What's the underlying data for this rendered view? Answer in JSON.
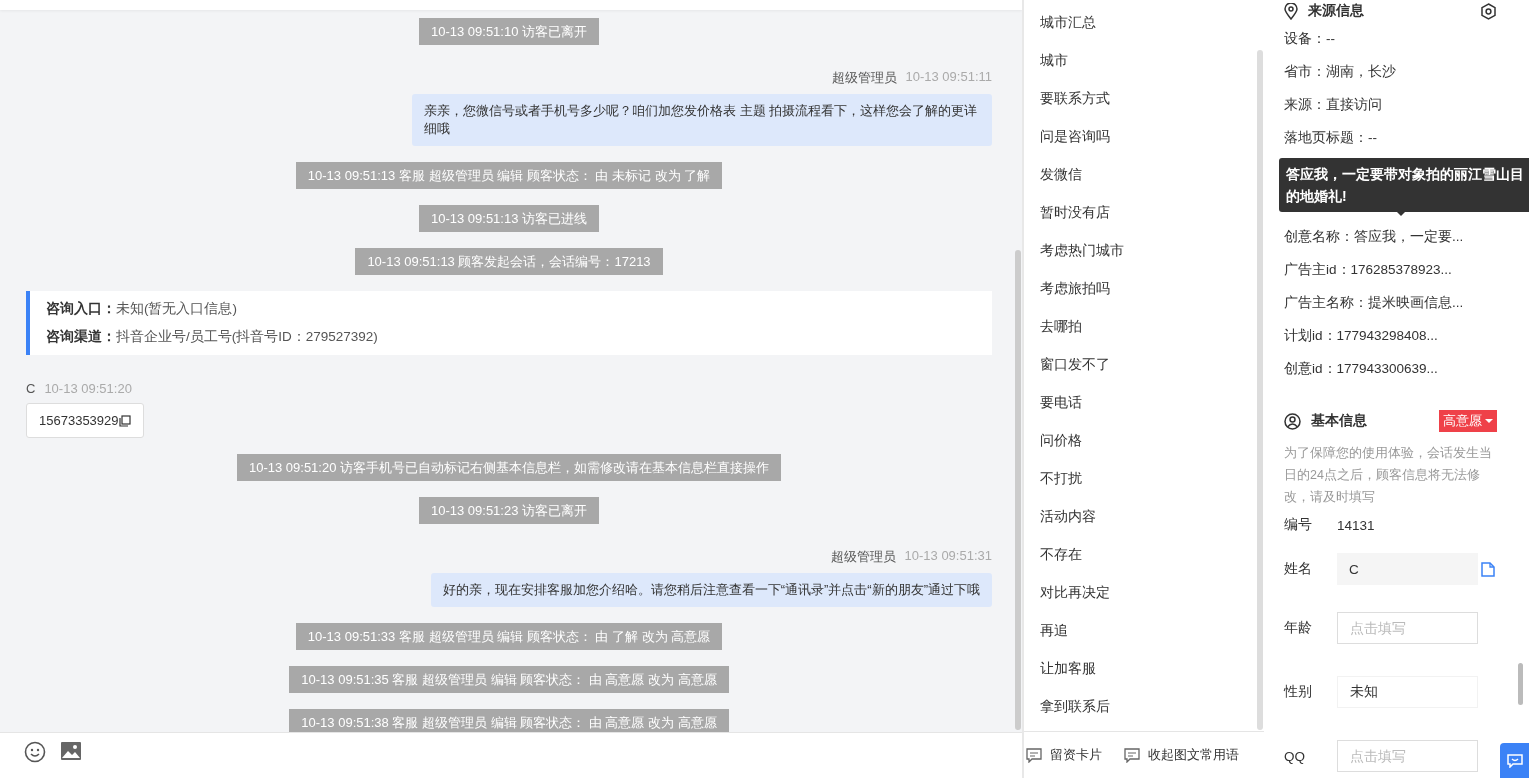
{
  "chat": {
    "messages": [
      {
        "kind": "system",
        "text": "10-13 09:51:10 访客已离开"
      },
      {
        "kind": "agent",
        "sender": "超级管理员",
        "time": "10-13 09:51:11",
        "text": "亲亲，您微信号或者手机号多少呢？咱们加您发价格表 主题 拍摄流程看下，这样您会了解的更详细哦"
      },
      {
        "kind": "system",
        "text": "10-13 09:51:13 客服 超级管理员 编辑 顾客状态： 由 未标记 改为 了解"
      },
      {
        "kind": "system",
        "text": "10-13 09:51:13 访客已进线"
      },
      {
        "kind": "system",
        "text": "10-13 09:51:13 顾客发起会话，会话编号：17213"
      },
      {
        "kind": "info",
        "lines": [
          "**咨询入口：**未知(暂无入口信息)",
          "**咨询渠道：**抖音企业号/员工号(抖音号ID：279527392)"
        ]
      },
      {
        "kind": "visitor",
        "sender": "C",
        "time": "10-13 09:51:20",
        "text": "15673353929"
      },
      {
        "kind": "system",
        "text": "10-13 09:51:20 访客手机号已自动标记右侧基本信息栏，如需修改请在基本信息栏直接操作"
      },
      {
        "kind": "system",
        "text": "10-13 09:51:23 访客已离开"
      },
      {
        "kind": "agent",
        "sender": "超级管理员",
        "time": "10-13 09:51:31",
        "text": "好的亲，现在安排客服加您介绍哈。请您稍后注意查看一下“通讯录”并点击“新的朋友”通过下哦"
      },
      {
        "kind": "system",
        "text": "10-13 09:51:33 客服 超级管理员 编辑 顾客状态： 由 了解 改为 高意愿"
      },
      {
        "kind": "system",
        "text": "10-13 09:51:35 客服 超级管理员 编辑 顾客状态： 由 高意愿 改为 高意愿"
      },
      {
        "kind": "system",
        "text": "10-13 09:51:38 客服 超级管理员 编辑 顾客状态： 由 高意愿 改为 高意愿"
      }
    ]
  },
  "quick_replies": {
    "items": [
      "城市汇总",
      "城市",
      "要联系方式",
      "问是咨询吗",
      "发微信",
      "暂时没有店",
      "考虑热门城市",
      "考虑旅拍吗",
      "去哪拍",
      "窗口发不了",
      "要电话",
      "问价格",
      "不打扰",
      "活动内容",
      "不存在",
      "对比再决定",
      "再追",
      "让加客服",
      "拿到联系后"
    ],
    "actions": [
      "留资卡片",
      "收起图文常用语"
    ]
  },
  "source_info": {
    "title": "来源信息",
    "rows": [
      "设备：--",
      "省市：湖南，长沙",
      "来源：直接访问",
      "落地页标题：--",
      "创意名称：答应我，一定要...",
      "广告主id：176285378923...",
      "广告主名称：提米映画信息...",
      "计划id：177943298408...",
      "创意id：177943300639..."
    ],
    "tooltip": "答应我，一定要带对象拍的丽江雪山目的地婚礼!"
  },
  "basic_info": {
    "title": "基本信息",
    "status": "高意愿",
    "note": "为了保障您的使用体验，会话发生当日的24点之后，顾客信息将无法修改，请及时填写",
    "fields": [
      {
        "kind": "text",
        "label": "编号",
        "value": "14131"
      },
      {
        "kind": "copyable",
        "label": "姓名",
        "value": "C"
      },
      {
        "kind": "input",
        "label": "年龄",
        "placeholder": "点击填写"
      },
      {
        "kind": "select",
        "label": "性别",
        "value": "未知"
      },
      {
        "kind": "input",
        "label": "QQ",
        "placeholder": "点击填写"
      }
    ]
  }
}
